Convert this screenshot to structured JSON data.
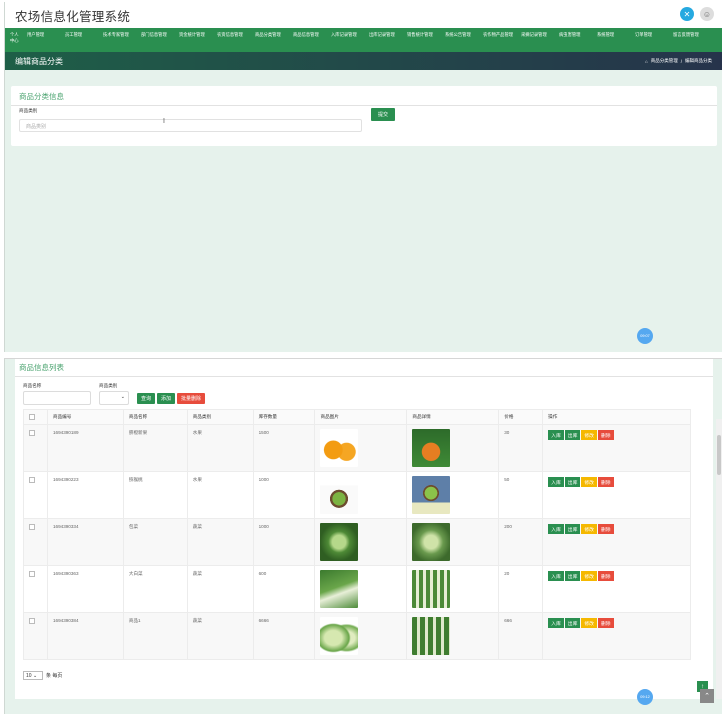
{
  "app": {
    "title": "农场信息化管理系统"
  },
  "nav": [
    "个人中心",
    "用户管理",
    "员工管理",
    "技术专家管理",
    "部门信息管理",
    "资金统计管理",
    "农资信息管理",
    "商品分类管理",
    "商品信息管理",
    "入库记录管理",
    "出库记录管理",
    "销售统计管理",
    "系统公告管理",
    "农作物产品管理",
    "采摘记录管理",
    "病虫害管理",
    "系统管理",
    "订单管理",
    "留言反馈管理"
  ],
  "subheader": {
    "title": "编辑商品分类",
    "breadcrumb": [
      "商品分类管理",
      "/",
      "编辑商品分类"
    ]
  },
  "form": {
    "section_title": "商品分类信息",
    "label": "商品类别",
    "placeholder": "商品类别",
    "submit": "提交"
  },
  "time_badge_top": "09:07",
  "list": {
    "section_title": "商品信息列表",
    "search": {
      "name_label": "商品名称",
      "type_label": "商品类别",
      "query": "查询",
      "add": "添加",
      "batch_delete": "批量删除"
    },
    "columns": [
      "商品编号",
      "商品名称",
      "商品类别",
      "库存数量",
      "商品图片",
      "商品详情",
      "价格",
      "操作"
    ],
    "rows": [
      {
        "id": "1694390189",
        "name": "脐橙新果",
        "type": "水果",
        "stock": "1500",
        "price": "30"
      },
      {
        "id": "1694390223",
        "name": "猕猴桃",
        "type": "水果",
        "stock": "1000",
        "price": "50"
      },
      {
        "id": "1694390334",
        "name": "包菜",
        "type": "蔬菜",
        "stock": "1000",
        "price": "200"
      },
      {
        "id": "1694390363",
        "name": "大白菜",
        "type": "蔬菜",
        "stock": "600",
        "price": "20"
      },
      {
        "id": "1694390384",
        "name": "商品1",
        "type": "蔬菜",
        "stock": "6666",
        "price": "666"
      }
    ],
    "ops": {
      "in": "入库",
      "out": "出库",
      "edit": "修改",
      "del": "删除"
    },
    "pager": {
      "size": "10",
      "per_page": "条 每页"
    }
  },
  "time_badge_bottom": "09:12",
  "colors": {
    "primary": "#2a8f50",
    "accent_text": "#4aa36f",
    "danger": "#e74c3c",
    "warn": "#f5b800"
  }
}
